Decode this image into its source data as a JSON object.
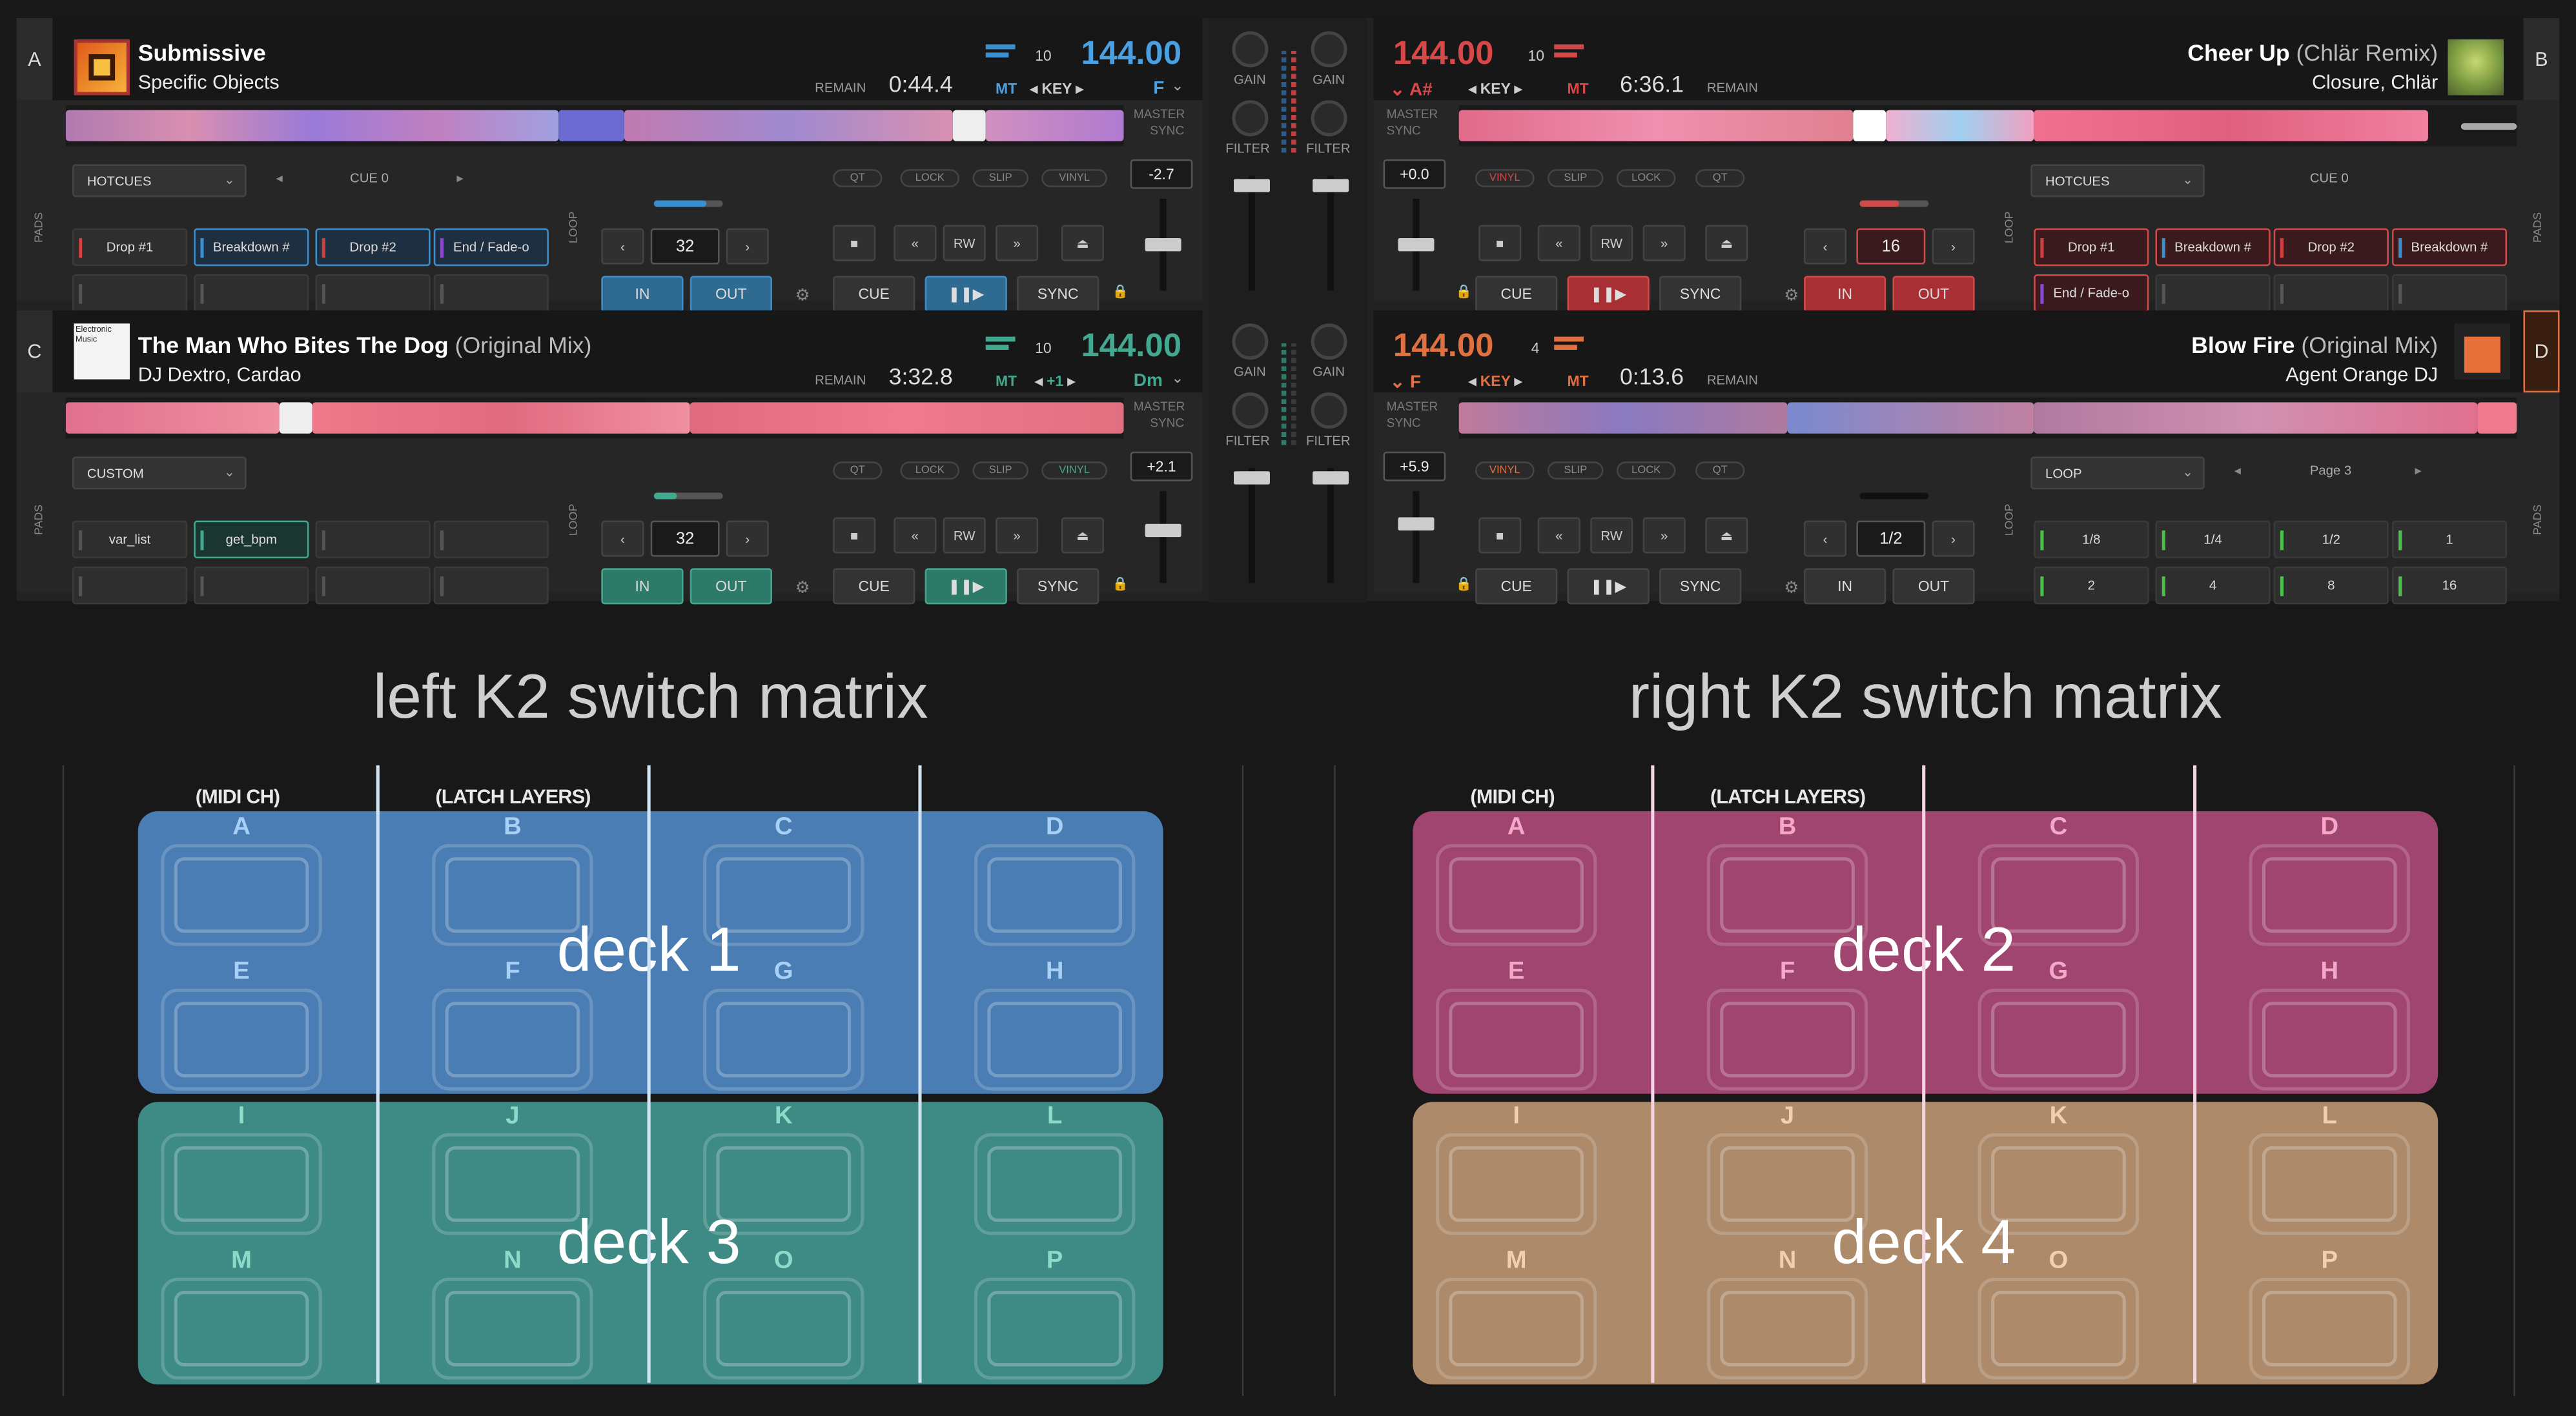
{
  "colors": {
    "blue": "#5a99d8",
    "red": "#d04a4a",
    "teal": "#42a88f",
    "orange": "#e07040"
  },
  "decks": {
    "a": {
      "letter": "A",
      "title": "Submissive",
      "title_suffix": "",
      "artist": "Specific Objects",
      "remain_label": "REMAIN",
      "time": "0:44.4",
      "bpm": "144.00",
      "beats": "10",
      "mt": "MT",
      "key_label": "KEY",
      "key_value": "F",
      "master": "MASTER",
      "sync": "SYNC"
    },
    "b": {
      "letter": "B",
      "title": "Cheer Up",
      "title_suffix": "(Chlär Remix)",
      "artist": "Closure, Chlär",
      "remain_label": "REMAIN",
      "time": "6:36.1",
      "bpm": "144.00",
      "beats": "10",
      "mt": "MT",
      "key_label": "KEY",
      "key_value": "A#",
      "master": "MASTER",
      "sync": "SYNC"
    },
    "c": {
      "letter": "C",
      "title": "The Man Who Bites The Dog",
      "title_suffix": "(Original Mix)",
      "artist": "DJ Dextro, Cardao",
      "remain_label": "REMAIN",
      "time": "3:32.8",
      "bpm": "144.00",
      "beats": "10",
      "mt": "MT",
      "key_label": "+1",
      "key_value": "Dm",
      "master": "MASTER",
      "sync": "SYNC",
      "art_text": "Electronic Music"
    },
    "d": {
      "letter": "D",
      "title": "Blow Fire",
      "title_suffix": "(Original Mix)",
      "artist": "Agent Orange DJ",
      "remain_label": "REMAIN",
      "time": "0:13.6",
      "bpm": "144.00",
      "beats": "4",
      "mt": "MT",
      "key_label": "KEY",
      "key_value": "F",
      "master": "MASTER",
      "sync": "SYNC"
    }
  },
  "panels": {
    "a": {
      "side": "PADS",
      "mode": "HOTCUES",
      "page": "CUE 0",
      "pads": [
        "Drop #1",
        "Breakdown #",
        "Drop #2",
        "End / Fade-o",
        "",
        "",
        "",
        ""
      ],
      "loop_label": "LOOP",
      "loop_value": "32",
      "in": "IN",
      "out": "OUT",
      "pitch": "-2.7",
      "pills": [
        "QT",
        "LOCK",
        "SLIP",
        "VINYL"
      ],
      "cue": "CUE",
      "play": "❚❚▶",
      "sync": "SYNC",
      "rw": "RW"
    },
    "b": {
      "side": "PADS",
      "mode": "HOTCUES",
      "page": "CUE 0",
      "pads": [
        "Drop #1",
        "Breakdown #",
        "Drop #2",
        "Breakdown #",
        "End / Fade-o",
        "",
        "",
        ""
      ],
      "loop_label": "LOOP",
      "loop_value": "16",
      "in": "IN",
      "out": "OUT",
      "pitch": "+0.0",
      "pills": [
        "VINYL",
        "SLIP",
        "LOCK",
        "QT"
      ],
      "cue": "CUE",
      "play": "❚❚▶",
      "sync": "SYNC",
      "rw": "RW"
    },
    "c": {
      "side": "PADS",
      "mode": "CUSTOM",
      "page": "",
      "pads": [
        "var_list",
        "get_bpm",
        "",
        "",
        "",
        "",
        "",
        ""
      ],
      "loop_label": "LOOP",
      "loop_value": "32",
      "in": "IN",
      "out": "OUT",
      "pitch": "+2.1",
      "pills": [
        "QT",
        "LOCK",
        "SLIP",
        "VINYL"
      ],
      "cue": "CUE",
      "play": "❚❚▶",
      "sync": "SYNC",
      "rw": "RW"
    },
    "d": {
      "side": "PADS",
      "mode": "LOOP",
      "page": "Page 3",
      "pads": [
        "1/8",
        "1/4",
        "1/2",
        "1",
        "2",
        "4",
        "8",
        "16"
      ],
      "loop_label": "LOOP",
      "loop_value": "1/2",
      "in": "IN",
      "out": "OUT",
      "pitch": "+5.9",
      "pills": [
        "VINYL",
        "SLIP",
        "LOCK",
        "QT"
      ],
      "cue": "CUE",
      "play": "❚❚▶",
      "sync": "SYNC",
      "rw": "RW"
    }
  },
  "mixer": {
    "gain": "GAIN",
    "filter": "FILTER"
  },
  "matrix": {
    "left_title": "left K2 switch matrix",
    "right_title": "right K2 switch matrix",
    "midi_ch": "(MIDI CH)",
    "latch": "(LATCH LAYERS)",
    "keys": [
      "A",
      "B",
      "C",
      "D",
      "E",
      "F",
      "G",
      "H",
      "I",
      "J",
      "K",
      "L",
      "M",
      "N",
      "O",
      "P"
    ],
    "deck1": "deck 1",
    "deck2": "deck 2",
    "deck3": "deck 3",
    "deck4": "deck 4"
  }
}
